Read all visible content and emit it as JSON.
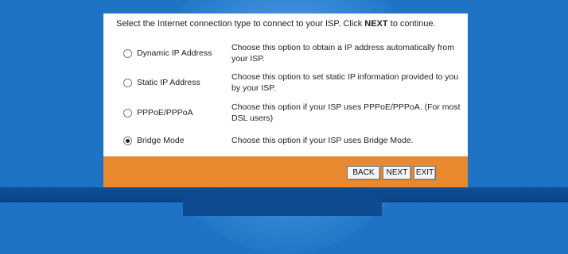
{
  "intro": {
    "text_before": "Select the Internet connection type to connect to your ISP. Click ",
    "text_bold": "NEXT",
    "text_after": " to continue."
  },
  "options": [
    {
      "label": "Dynamic IP Address",
      "desc": "Choose this option to obtain a IP address automatically from your ISP.",
      "checked": false
    },
    {
      "label": "Static IP Address",
      "desc": "Choose this option to set static IP information provided to you by your ISP.",
      "checked": false
    },
    {
      "label": "PPPoE/PPPoA",
      "desc": "Choose this option if your ISP uses PPPoE/PPPoA. (For most DSL users)",
      "checked": false
    },
    {
      "label": "Bridge Mode",
      "desc": "Choose this option if your ISP uses Bridge Mode.",
      "checked": true
    }
  ],
  "buttons": {
    "back": "BACK",
    "next": "NEXT",
    "exit": "EXIT"
  },
  "colors": {
    "background": "#1e73c4",
    "footer": "#e8892f",
    "panel": "#ffffff"
  }
}
